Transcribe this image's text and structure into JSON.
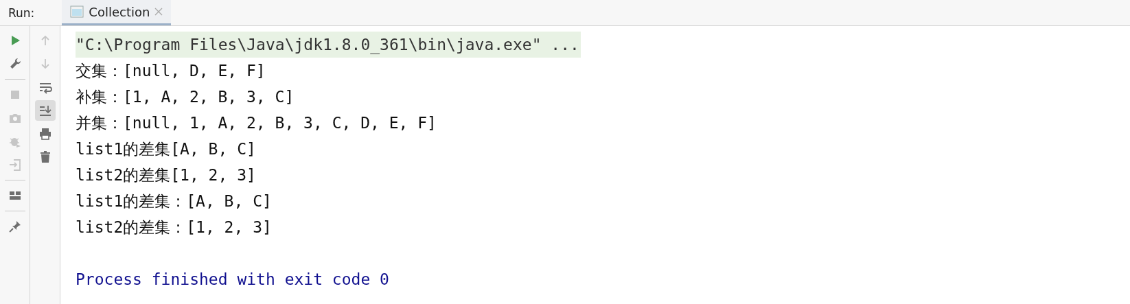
{
  "run_label": "Run:",
  "tabs": [
    {
      "label": "Collection",
      "selected": true,
      "closable": true
    }
  ],
  "toolbar_left": [
    {
      "kind": "run",
      "disabled": false
    },
    {
      "kind": "wrench",
      "disabled": false
    },
    {
      "kind": "separator"
    },
    {
      "kind": "stop",
      "disabled": true
    },
    {
      "kind": "camera",
      "disabled": true
    },
    {
      "kind": "bug",
      "disabled": true
    },
    {
      "kind": "exit",
      "disabled": true
    },
    {
      "kind": "separator"
    },
    {
      "kind": "layout",
      "disabled": false
    },
    {
      "kind": "separator"
    },
    {
      "kind": "pin",
      "disabled": false
    }
  ],
  "toolbar_right": [
    {
      "kind": "up",
      "disabled": true,
      "selected": false
    },
    {
      "kind": "down",
      "disabled": true,
      "selected": false
    },
    {
      "kind": "wrap",
      "disabled": false,
      "selected": false
    },
    {
      "kind": "scroll",
      "disabled": false,
      "selected": true
    },
    {
      "kind": "print",
      "disabled": false,
      "selected": false
    },
    {
      "kind": "trash",
      "disabled": false,
      "selected": false
    }
  ],
  "console": [
    {
      "kind": "command",
      "text": "\"C:\\Program Files\\Java\\jdk1.8.0_361\\bin\\java.exe\" ..."
    },
    {
      "kind": "output",
      "text": "交集：[null, D, E, F]"
    },
    {
      "kind": "output",
      "text": "补集：[1, A, 2, B, 3, C]"
    },
    {
      "kind": "output",
      "text": "并集：[null, 1, A, 2, B, 3, C, D, E, F]"
    },
    {
      "kind": "output",
      "text": "list1的差集[A, B, C]"
    },
    {
      "kind": "output",
      "text": "list2的差集[1, 2, 3]"
    },
    {
      "kind": "output",
      "text": "list1的差集：[A, B, C]"
    },
    {
      "kind": "output",
      "text": "list2的差集：[1, 2, 3]"
    },
    {
      "kind": "blank"
    },
    {
      "kind": "exit",
      "text": "Process finished with exit code 0"
    }
  ]
}
